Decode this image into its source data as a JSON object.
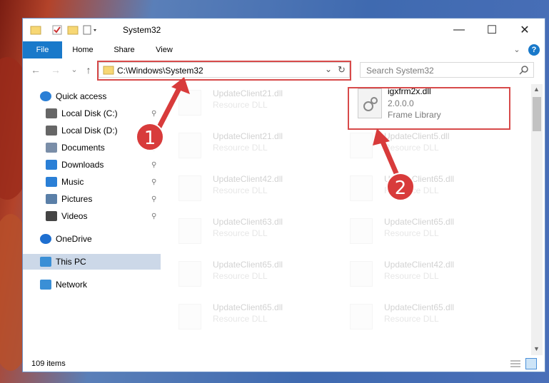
{
  "window": {
    "title": "System32",
    "min": "—",
    "max": "☐",
    "close": "✕"
  },
  "ribbon": {
    "tabs": [
      "File",
      "Home",
      "Share",
      "View"
    ],
    "expand": "⌄",
    "help": "?"
  },
  "nav": {
    "back": "←",
    "forward": "→",
    "recent": "⌄",
    "up": "↑",
    "address": "C:\\Windows\\System32",
    "search_placeholder": "Search System32"
  },
  "sidebar": {
    "items": [
      {
        "label": "Quick access",
        "icon": "star-icon",
        "pinned": false
      },
      {
        "label": "Local Disk (C:)",
        "icon": "drive-icon",
        "pinned": true
      },
      {
        "label": "Local Disk (D:)",
        "icon": "drive-icon",
        "pinned": true
      },
      {
        "label": "Documents",
        "icon": "documents-icon",
        "pinned": true
      },
      {
        "label": "Downloads",
        "icon": "download-icon",
        "pinned": true
      },
      {
        "label": "Music",
        "icon": "music-icon",
        "pinned": true
      },
      {
        "label": "Pictures",
        "icon": "pictures-icon",
        "pinned": true
      },
      {
        "label": "Videos",
        "icon": "videos-icon",
        "pinned": true
      },
      {
        "label": "OneDrive",
        "icon": "cloud-icon",
        "pinned": false
      },
      {
        "label": "This PC",
        "icon": "computer-icon",
        "pinned": false
      },
      {
        "label": "Network",
        "icon": "network-icon",
        "pinned": false
      }
    ]
  },
  "files": {
    "highlighted": {
      "name": "igxfrm2x.dll",
      "version": "2.0.0.0",
      "type": "Frame Library"
    },
    "ghost": [
      {
        "name": "UpdateClient21.dll",
        "type": "Resource DLL"
      },
      {
        "name": "UpdateClient21.dll",
        "type": "Resource DLL"
      },
      {
        "name": "UpdateClient5.dll",
        "type": "Resource DLL"
      },
      {
        "name": "UpdateClient42.dll",
        "type": "Resource DLL"
      },
      {
        "name": "UpdateClient65.dll",
        "type": "Resource DLL"
      },
      {
        "name": "UpdateClient63.dll",
        "type": "Resource DLL"
      },
      {
        "name": "UpdateClient65.dll",
        "type": "Resource DLL"
      },
      {
        "name": "UpdateClient65.dll",
        "type": "Resource DLL"
      },
      {
        "name": "UpdateClient42.dll",
        "type": "Resource DLL"
      },
      {
        "name": "UpdateClient65.dll",
        "type": "Resource DLL"
      },
      {
        "name": "UpdateClient65.dll",
        "type": "Resource DLL"
      }
    ]
  },
  "status": {
    "count": "109 items"
  },
  "annotations": {
    "step1": "1",
    "step2": "2",
    "color": "#d83b3b"
  },
  "colors": {
    "accent": "#1979ca",
    "highlight": "#d74a4a"
  }
}
